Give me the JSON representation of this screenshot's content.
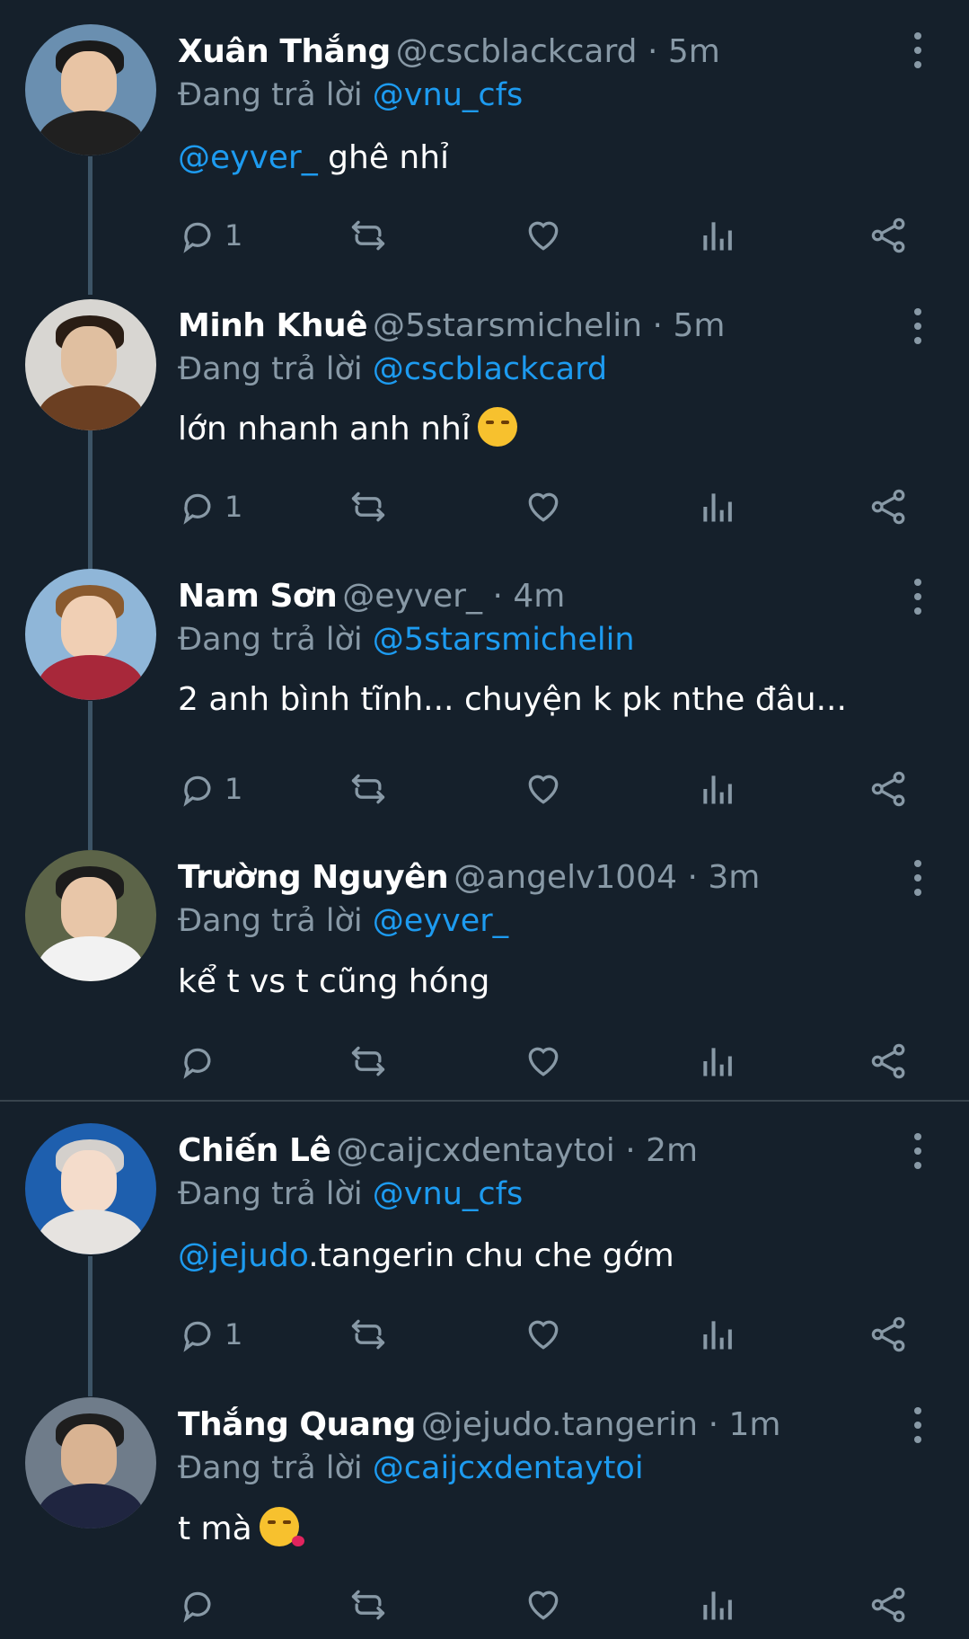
{
  "reply_prefix": "Đang trả lời",
  "colors": {
    "background": "#15202b",
    "text": "#ffffff",
    "muted": "#8899a6",
    "link": "#1d9bf0",
    "thread_line": "#3d5466"
  },
  "action_icons": [
    "reply-icon",
    "retweet-icon",
    "like-icon",
    "analytics-icon",
    "share-icon"
  ],
  "tweets": [
    {
      "name": "Xuân Thắng",
      "handle": "@cscblackcard",
      "dot": "·",
      "time": "5m",
      "replying_to": "@vnu_cfs",
      "text_mention": "@eyver_",
      "text": " ghê nhỉ",
      "reply_count": "1"
    },
    {
      "name": "Minh Khuê",
      "handle": "@5starsmichelin",
      "dot": "·",
      "time": "5m",
      "replying_to": "@cscblackcard",
      "text_mention": "",
      "text": "lớn nhanh anh nhỉ",
      "emoji": "smirking-face",
      "reply_count": "1"
    },
    {
      "name": "Nam Sơn",
      "handle": "@eyver_",
      "dot": "·",
      "time": "4m",
      "replying_to": "@5starsmichelin",
      "text_mention": "",
      "text": "2 anh bình tĩnh... chuyện k pk nthe đâu...",
      "reply_count": "1"
    },
    {
      "name": "Trường Nguyên",
      "handle": "@angelv1004",
      "dot": "·",
      "time": "3m",
      "replying_to": "@eyver_",
      "text_mention": "",
      "text": "kể t vs t cũng hóng",
      "reply_count": ""
    },
    {
      "name": "Chiến Lê",
      "handle": "@caijcxdentaytoi",
      "dot": "·",
      "time": "2m",
      "replying_to": "@vnu_cfs",
      "text_mention": "@jejudo",
      "text": ".tangerin chu che gớm",
      "reply_count": "1"
    },
    {
      "name": "Thắng Quang",
      "handle": "@jejudo.tangerin",
      "dot": "·",
      "time": "1m",
      "replying_to": "@caijcxdentaytoi",
      "text_mention": "",
      "text": "t mà",
      "emoji": "face-blowing-kiss",
      "reply_count": ""
    }
  ]
}
